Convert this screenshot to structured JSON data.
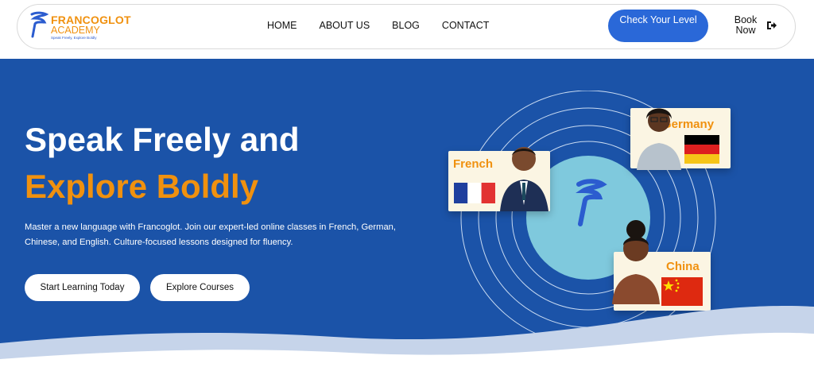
{
  "brand": {
    "name": "FRANCOGLOT",
    "sub": "ACADEMY",
    "tagline": "Speak Freely, Explore Boldly"
  },
  "nav": {
    "links": [
      "HOME",
      "ABOUT US",
      "BLOG",
      "CONTACT"
    ],
    "cta_label": "Check Your Level",
    "book_label": "Book Now",
    "book_icon": "sign-out-icon"
  },
  "hero": {
    "title_line1": "Speak Freely and",
    "title_line2": "Explore Boldly",
    "description": "Master a new language with Francoglot. Join our expert-led online classes in French, German, Chinese, and English. Culture-focused lessons designed for fluency.",
    "primary_button": "Start Learning Today",
    "secondary_button": "Explore Courses"
  },
  "cards": {
    "french": "French",
    "germany": "Germany",
    "china": "China"
  },
  "colors": {
    "hero_bg": "#1b53a8",
    "accent_orange": "#f0910f",
    "cta_blue": "#2a68d8",
    "circle": "#7fc9dd"
  }
}
